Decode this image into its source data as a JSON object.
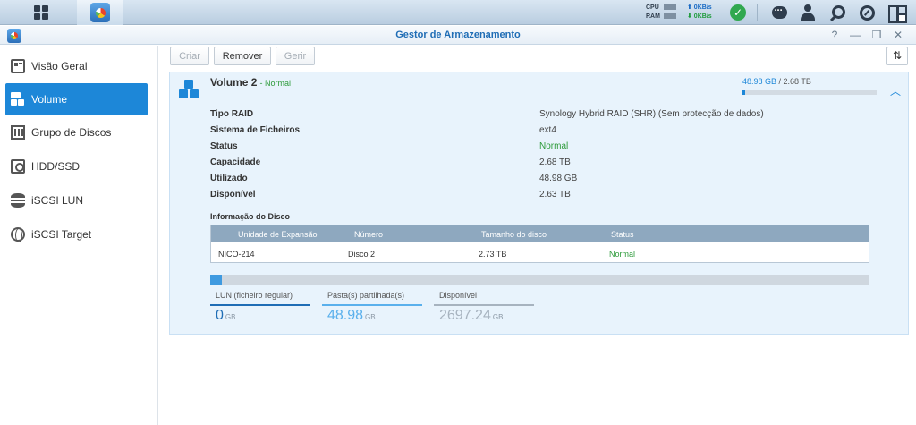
{
  "taskbar": {
    "cpu_label": "CPU",
    "ram_label": "RAM",
    "upload": "⬆ 0KB/s",
    "download": "⬇ 0KB/s",
    "status_icon": "check-icon"
  },
  "window": {
    "title": "Gestor de Armazenamento",
    "controls": [
      "?",
      "—",
      "❐",
      "✕"
    ]
  },
  "sidebar": {
    "items": [
      {
        "label": "Visão Geral",
        "icon": "overview-icon"
      },
      {
        "label": "Volume",
        "icon": "volume-icon",
        "active": true
      },
      {
        "label": "Grupo de Discos",
        "icon": "disk-group-icon"
      },
      {
        "label": "HDD/SSD",
        "icon": "hdd-icon"
      },
      {
        "label": "iSCSI LUN",
        "icon": "iscsi-lun-icon"
      },
      {
        "label": "iSCSI Target",
        "icon": "iscsi-target-icon"
      }
    ]
  },
  "toolbar": {
    "create_label": "Criar",
    "remove_label": "Remover",
    "manage_label": "Gerir",
    "sort_icon": "⇅"
  },
  "volume": {
    "name": "Volume 2",
    "status_suffix": "- Normal",
    "used": "48.98 GB",
    "total": " / 2.68 TB",
    "used_fraction": 0.018,
    "properties": [
      {
        "label": "Tipo RAID",
        "value": "Synology Hybrid RAID (SHR) (Sem protecção de dados)"
      },
      {
        "label": "Sistema de Ficheiros",
        "value": "ext4"
      },
      {
        "label": "Status",
        "value": "Normal"
      },
      {
        "label": "Capacidade",
        "value": "2.68 TB"
      },
      {
        "label": "Utilizado",
        "value": "48.98 GB"
      },
      {
        "label": "Disponível",
        "value": "2.63 TB"
      }
    ],
    "disk_info_title": "Informação do Disco",
    "disk_table": {
      "headers": [
        "Unidade de Expansão",
        "Número",
        "Tamanho do disco",
        "Status"
      ],
      "rows": [
        [
          "NICO-214",
          "Disco 2",
          "2.73 TB",
          "Normal"
        ]
      ]
    },
    "capacity_fraction": 0.018,
    "stats": [
      {
        "label": "LUN (ficheiro regular)",
        "value": "0",
        "unit": "GB",
        "color": "#1f6db5"
      },
      {
        "label": "Pasta(s) partilhada(s)",
        "value": "48.98",
        "unit": "GB",
        "color": "#5ab0ec"
      },
      {
        "label": "Disponível",
        "value": "2697.24",
        "unit": "GB",
        "color": "#a7b3bf"
      }
    ]
  }
}
